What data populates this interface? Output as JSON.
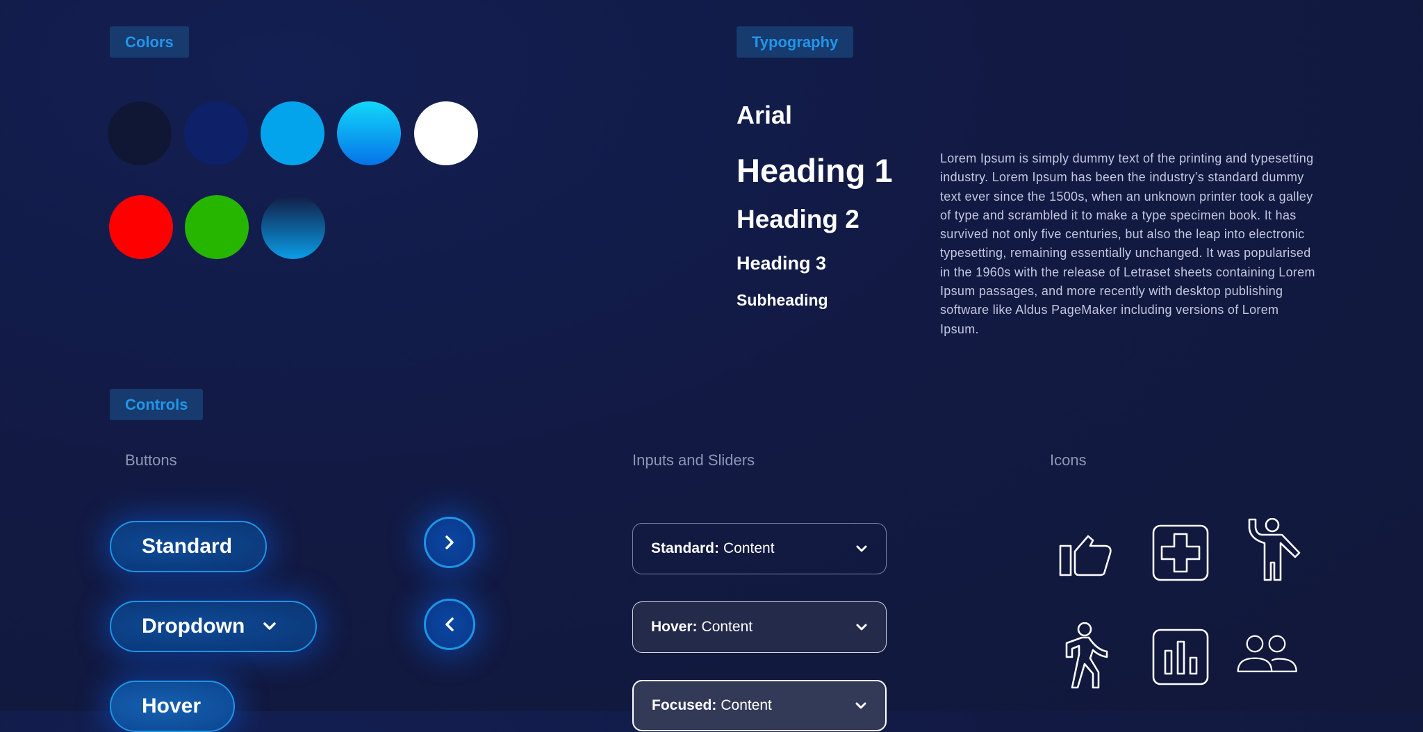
{
  "sections": {
    "colors": "Colors",
    "typography": "Typography",
    "controls": "Controls"
  },
  "colors": {
    "row1": [
      {
        "name": "dark-navy",
        "value": "#101734"
      },
      {
        "name": "navy",
        "value": "#0e2068"
      },
      {
        "name": "sky-blue",
        "value": "#04a4ec"
      },
      {
        "name": "cyan-blue-gradient",
        "value": "linear-gradient(#12d8fa, #0573e8)"
      },
      {
        "name": "white",
        "value": "#ffffff"
      }
    ],
    "row2": [
      {
        "name": "red",
        "value": "#ff0000"
      },
      {
        "name": "green",
        "value": "#26b600"
      },
      {
        "name": "navy-blue-gradient",
        "value": "linear-gradient(#121c44, #0a9de6)"
      }
    ]
  },
  "typography": {
    "font_name": "Arial",
    "heading1": "Heading 1",
    "heading2": "Heading 2",
    "heading3": "Heading 3",
    "subheading": "Subheading",
    "body": "Lorem Ipsum is simply dummy text of the printing and typesetting industry. Lorem Ipsum has been the industry’s standard dummy text ever since the 1500s, when an unknown printer took a galley of type and scrambled it to make a type specimen book. It has survived not only five centuries, but also the leap into electronic typesetting, remaining essentially unchanged. It was popularised in the 1960s with the release of Letraset sheets containing Lorem Ipsum passages, and more recently with desktop publishing software like Aldus PageMaker including versions of Lorem Ipsum."
  },
  "controls": {
    "buttons_label": "Buttons",
    "inputs_label": "Inputs and Sliders",
    "icons_label": "Icons",
    "buttons": {
      "standard": "Standard",
      "dropdown": "Dropdown",
      "hover": "Hover"
    },
    "selects": [
      {
        "state": "Standard:",
        "value": "Content"
      },
      {
        "state": "Hover:",
        "value": "Content"
      },
      {
        "state": "Focused:",
        "value": "Content"
      }
    ],
    "icons": [
      "thumbs-up-icon",
      "medical-cross-icon",
      "person-waving-icon",
      "person-walking-icon",
      "bar-chart-icon",
      "people-icon"
    ]
  },
  "accent": "#1e95e6"
}
